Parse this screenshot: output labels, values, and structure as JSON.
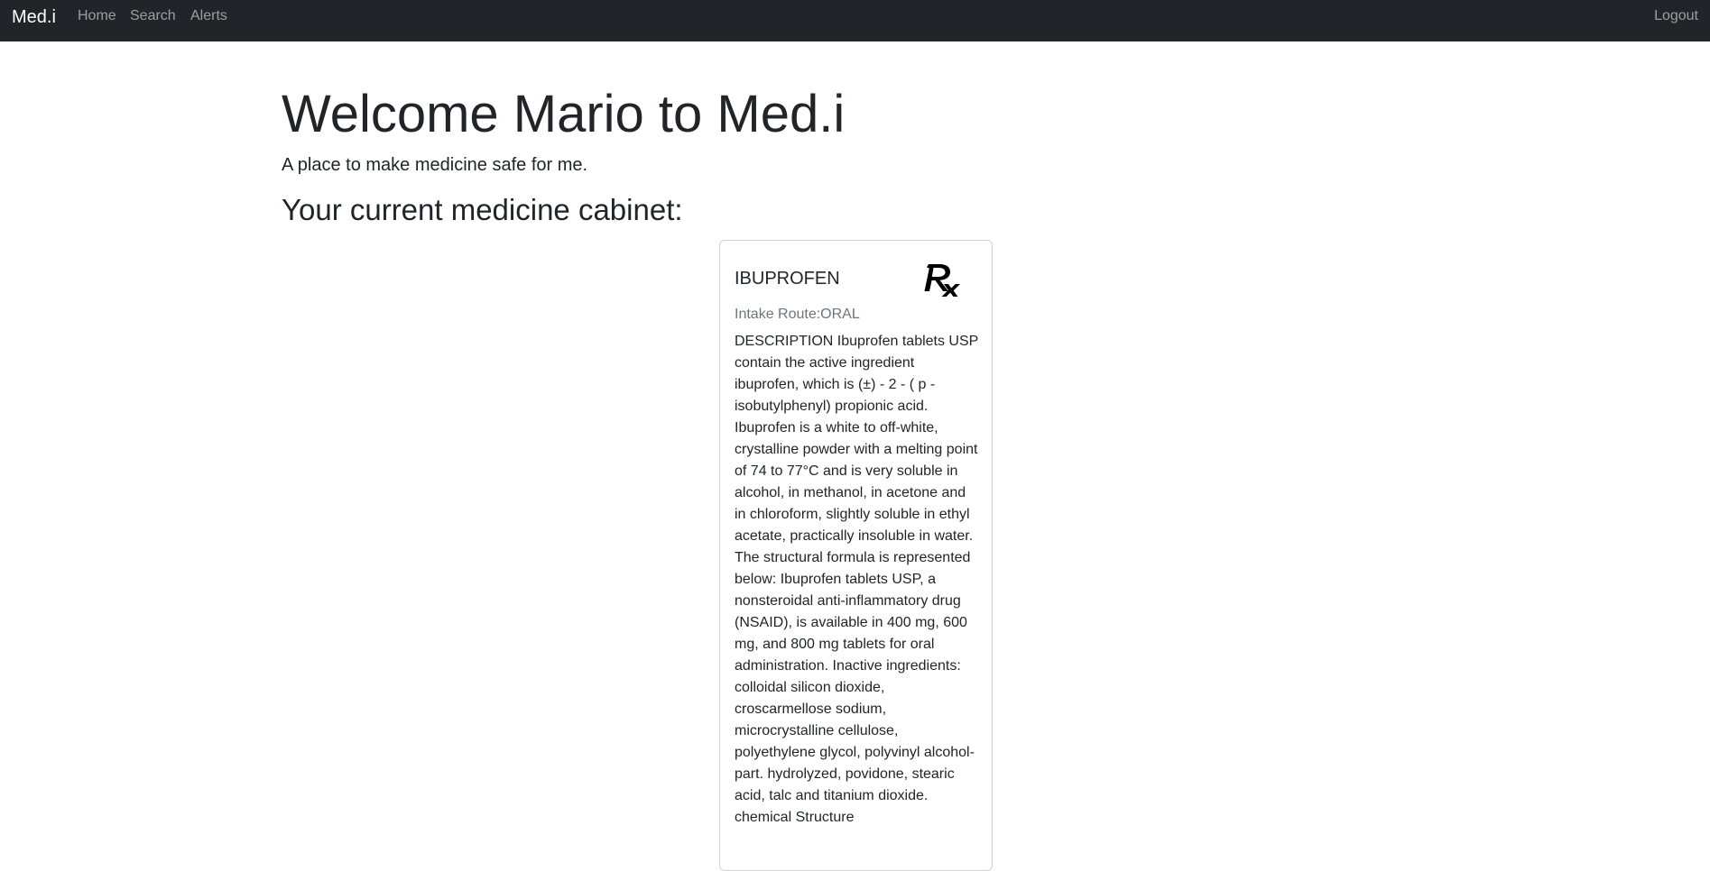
{
  "navbar": {
    "brand": "Med.i",
    "links": [
      {
        "label": "Home"
      },
      {
        "label": "Search"
      },
      {
        "label": "Alerts"
      }
    ],
    "logout_label": "Logout"
  },
  "main": {
    "title": "Welcome Mario to Med.i",
    "lead": "A place to make medicine safe for me.",
    "cabinet_heading": "Your current medicine cabinet:"
  },
  "cabinet": {
    "items": [
      {
        "name": "IBUPROFEN",
        "icon": "rx-icon",
        "intake_route": "Intake Route:ORAL",
        "description": "DESCRIPTION Ibuprofen tablets USP contain the active ingredient ibuprofen, which is (±) - 2 - ( p - isobutylphenyl) propionic acid. Ibuprofen is a white to off-white, crystalline powder with a melting point of 74 to 77°C and is very soluble in alcohol, in methanol, in acetone and in chloroform, slightly soluble in ethyl acetate, practically insoluble in water. The structural formula is represented below: Ibuprofen tablets USP, a nonsteroidal anti-inflammatory drug (NSAID), is available in 400 mg, 600 mg, and 800 mg tablets for oral administration. Inactive ingredients: colloidal silicon dioxide, croscarmellose sodium, microcrystalline cellulose, polyethylene glycol, polyvinyl alcohol-part. hydrolyzed, povidone, stearic acid, talc and titanium dioxide. chemical Structure"
      }
    ]
  },
  "colors": {
    "navbar_bg": "#212529",
    "nav_link": "rgba(255,255,255,0.55)",
    "text": "#212529",
    "muted": "#6c757d"
  }
}
